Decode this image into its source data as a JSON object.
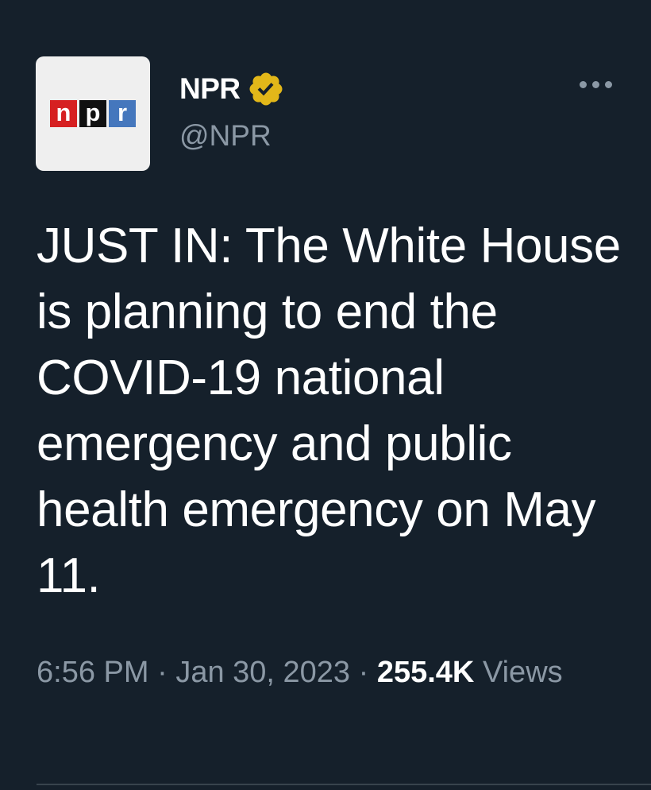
{
  "colors": {
    "background": "#15202b",
    "text_primary": "#ffffff",
    "text_secondary": "#8b98a5",
    "verified_badge": "#e2b719",
    "divider": "#38444d",
    "logo_n": "#d62021",
    "logo_p": "#111111",
    "logo_r": "#4577bd"
  },
  "author": {
    "avatar_logo": [
      "n",
      "p",
      "r"
    ],
    "name": "NPR",
    "verified_icon": "verified-badge-gold",
    "handle": "@NPR"
  },
  "menu": {
    "icon": "more-options-icon"
  },
  "tweet": {
    "text": "JUST IN: The White House is planning to end the COVID-19 national emergency and public health emergency on May 11.",
    "time": "6:56 PM",
    "separator": "·",
    "date": "Jan 30, 2023",
    "views_count": "255.4K",
    "views_label": "Views"
  }
}
